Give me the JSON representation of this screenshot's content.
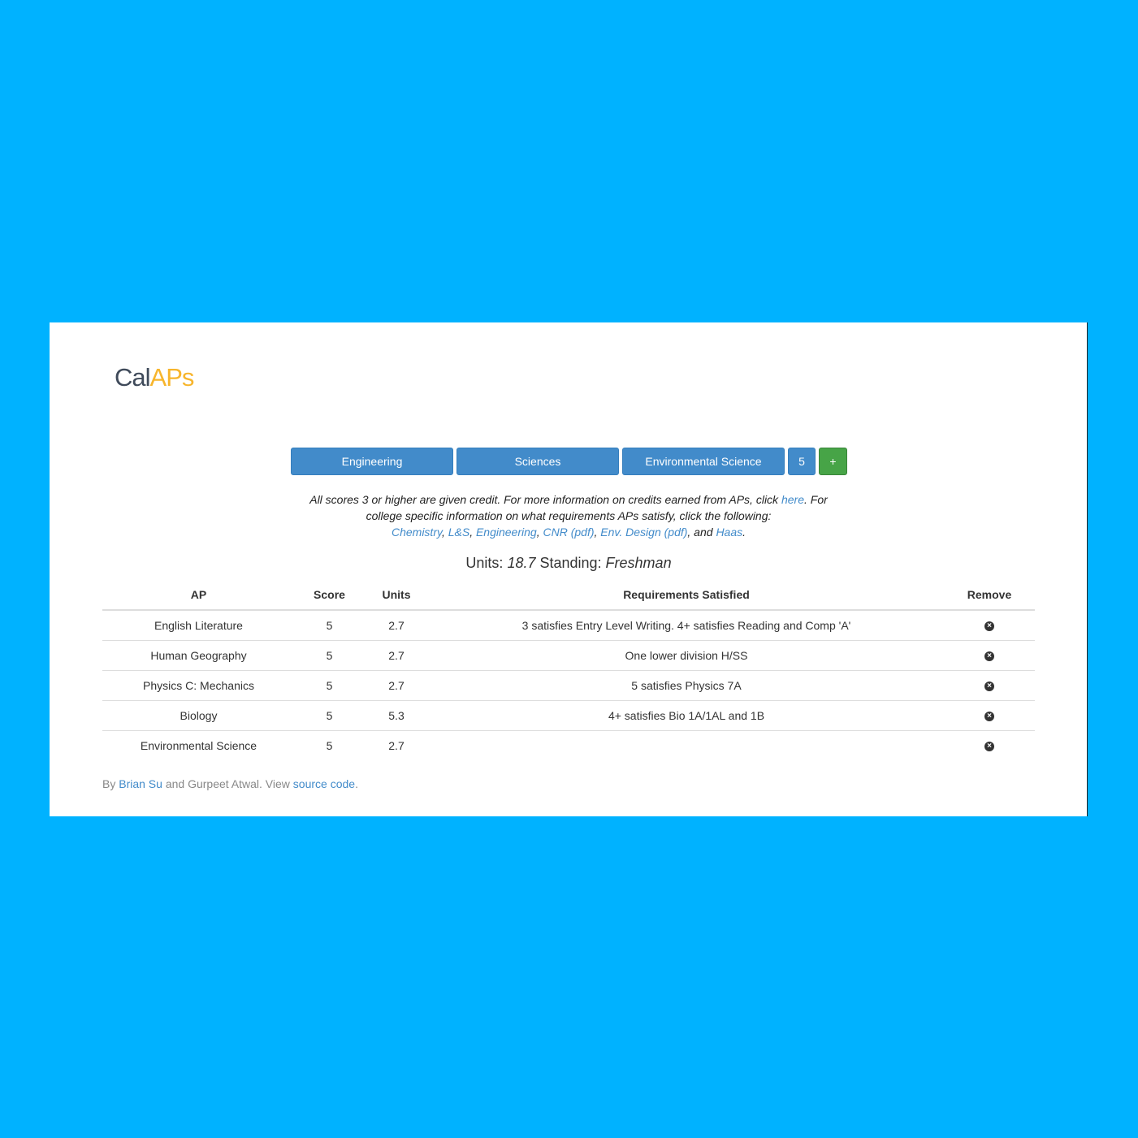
{
  "brand": {
    "part1": "Cal",
    "part2": "APs"
  },
  "controls": {
    "college": "Engineering",
    "category": "Sciences",
    "exam": "Environmental Science",
    "score": "5",
    "add_label": "+"
  },
  "info": {
    "line1": "All scores 3 or higher are given credit. For more information on credits earned from APs, click",
    "here": "here",
    "line2": ". For college specific information on what requirements APs satisfy, click the following:",
    "links": [
      "Chemistry",
      "L&S",
      "Engineering",
      "CNR (pdf)",
      "Env. Design (pdf)",
      "Haas"
    ],
    "sep": ", ",
    "and_text": ", and ",
    "end": "."
  },
  "totals": {
    "units_label": "Units: ",
    "units_value": "18.7",
    "standing_label": " Standing: ",
    "standing_value": "Freshman"
  },
  "table": {
    "headers": [
      "AP",
      "Score",
      "Units",
      "Requirements Satisfied",
      "Remove"
    ],
    "rows": [
      [
        "English Literature",
        "5",
        "2.7",
        "3 satisfies Entry Level Writing. 4+ satisfies Reading and Comp 'A'"
      ],
      [
        "Human Geography",
        "5",
        "2.7",
        "One lower division H/SS"
      ],
      [
        "Physics C: Mechanics",
        "5",
        "2.7",
        "5 satisfies Physics 7A"
      ],
      [
        "Biology",
        "5",
        "5.3",
        "4+ satisfies Bio 1A/1AL and 1B"
      ],
      [
        "Environmental Science",
        "5",
        "2.7",
        ""
      ]
    ],
    "remove_icon": "close-circle-icon",
    "remove_glyph": "×"
  },
  "footer": {
    "by": "By ",
    "author1": "Brian Su",
    "and_text": " and Gurpeet Atwal. View ",
    "source": "source code",
    "end": "."
  },
  "colors": {
    "background": "#00b2ff",
    "primary": "#428bca",
    "success": "#47a447",
    "accent": "#f7b52c"
  }
}
